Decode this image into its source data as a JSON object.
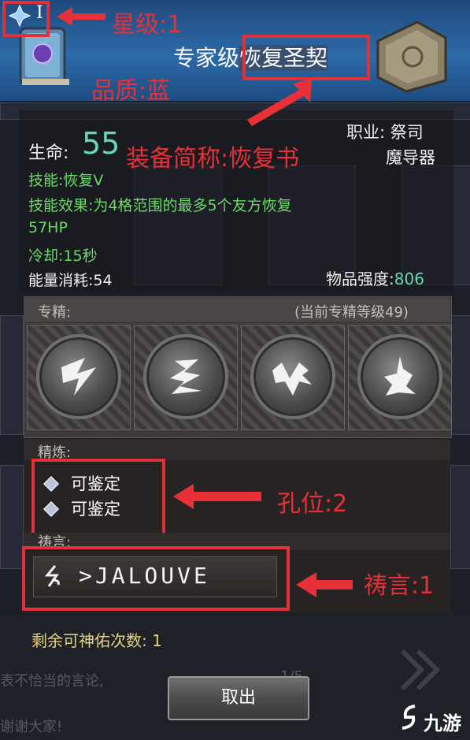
{
  "header": {
    "tier_numeral": "I",
    "item_title_prefix": "专家级",
    "item_title_name": "恢复圣契"
  },
  "stats": {
    "hp_label": "生命:",
    "hp_value": "55",
    "job_label": "职业: 祭司",
    "job_value2": "魔导器",
    "skill": "技能:恢复V",
    "effect_line1": "技能效果:为4格范围的最多5个友方恢复",
    "effect_line2": "57HP",
    "cooldown": "冷却:15秒",
    "energy": "能量消耗:54",
    "strength_label": "物品强度:",
    "strength_value": "806"
  },
  "specialization": {
    "label": "专精:",
    "current_level": "(当前专精等级49)",
    "emblems": [
      "emblem-1",
      "emblem-2",
      "emblem-3",
      "emblem-4"
    ]
  },
  "refining": {
    "label": "精炼:",
    "sockets": [
      "可鉴定",
      "可鉴定"
    ]
  },
  "prayer": {
    "label": "祷言:",
    "rune_text": ">JALOUVE"
  },
  "remaining": {
    "label": "剩余可神佑次数: 1"
  },
  "background_text": {
    "chat_line1": "表不恰当的言论,",
    "chat_line2": "谢谢大家!",
    "page": "1/5"
  },
  "cancel_button": "取出",
  "annotations": {
    "star": "星级:1",
    "quality": "品质:蓝",
    "short_name": "装备简称:恢复书",
    "sockets": "孔位:2",
    "prayer": "祷言:1"
  },
  "watermark": "九游",
  "colors": {
    "annotation_red": "#e83038",
    "skill_green": "#6cd86a",
    "header_blue": "#2c6aa8"
  }
}
